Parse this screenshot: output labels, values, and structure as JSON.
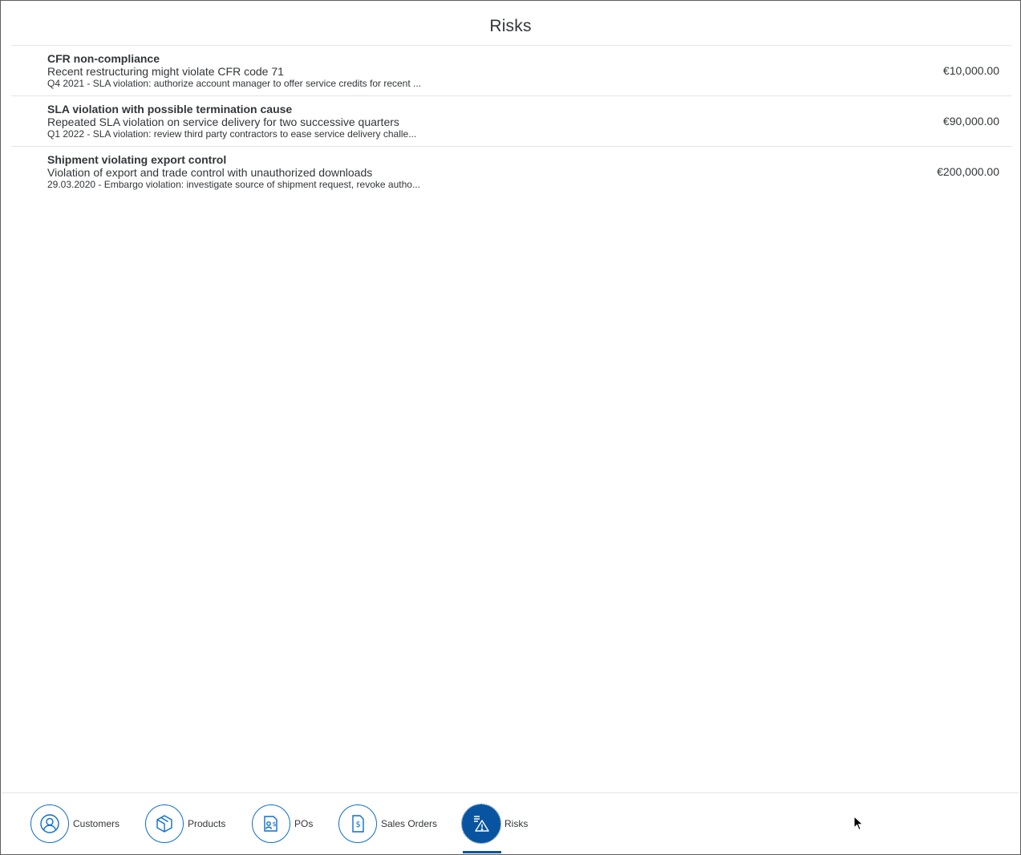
{
  "page": {
    "title": "Risks"
  },
  "risks": [
    {
      "title": "CFR non-compliance",
      "description": "Recent restructuring might violate CFR code 71",
      "mitigation": "Q4 2021 - SLA violation: authorize account manager to offer service credits for recent ...",
      "amount": "€10,000.00"
    },
    {
      "title": "SLA violation with possible termination cause",
      "description": "Repeated SLA violation on service delivery for two successive quarters",
      "mitigation": "Q1 2022 - SLA violation: review third party contractors to ease service delivery challe...",
      "amount": "€90,000.00"
    },
    {
      "title": "Shipment violating export control",
      "description": "Violation of export and trade control with unauthorized downloads",
      "mitigation": "29.03.2020 - Embargo violation: investigate source of shipment request, revoke autho...",
      "amount": "€200,000.00"
    }
  ],
  "nav": {
    "items": [
      {
        "label": "Customers",
        "icon": "customer-icon",
        "active": false
      },
      {
        "label": "Products",
        "icon": "product-icon",
        "active": false
      },
      {
        "label": "POs",
        "icon": "purchase-order-icon",
        "active": false
      },
      {
        "label": "Sales Orders",
        "icon": "sales-order-icon",
        "active": false
      },
      {
        "label": "Risks",
        "icon": "risk-icon",
        "active": true
      }
    ]
  },
  "colors": {
    "accent": "#0a6ed1",
    "active": "#0854a0",
    "text": "#32363a",
    "divider": "#e5e5e5"
  }
}
